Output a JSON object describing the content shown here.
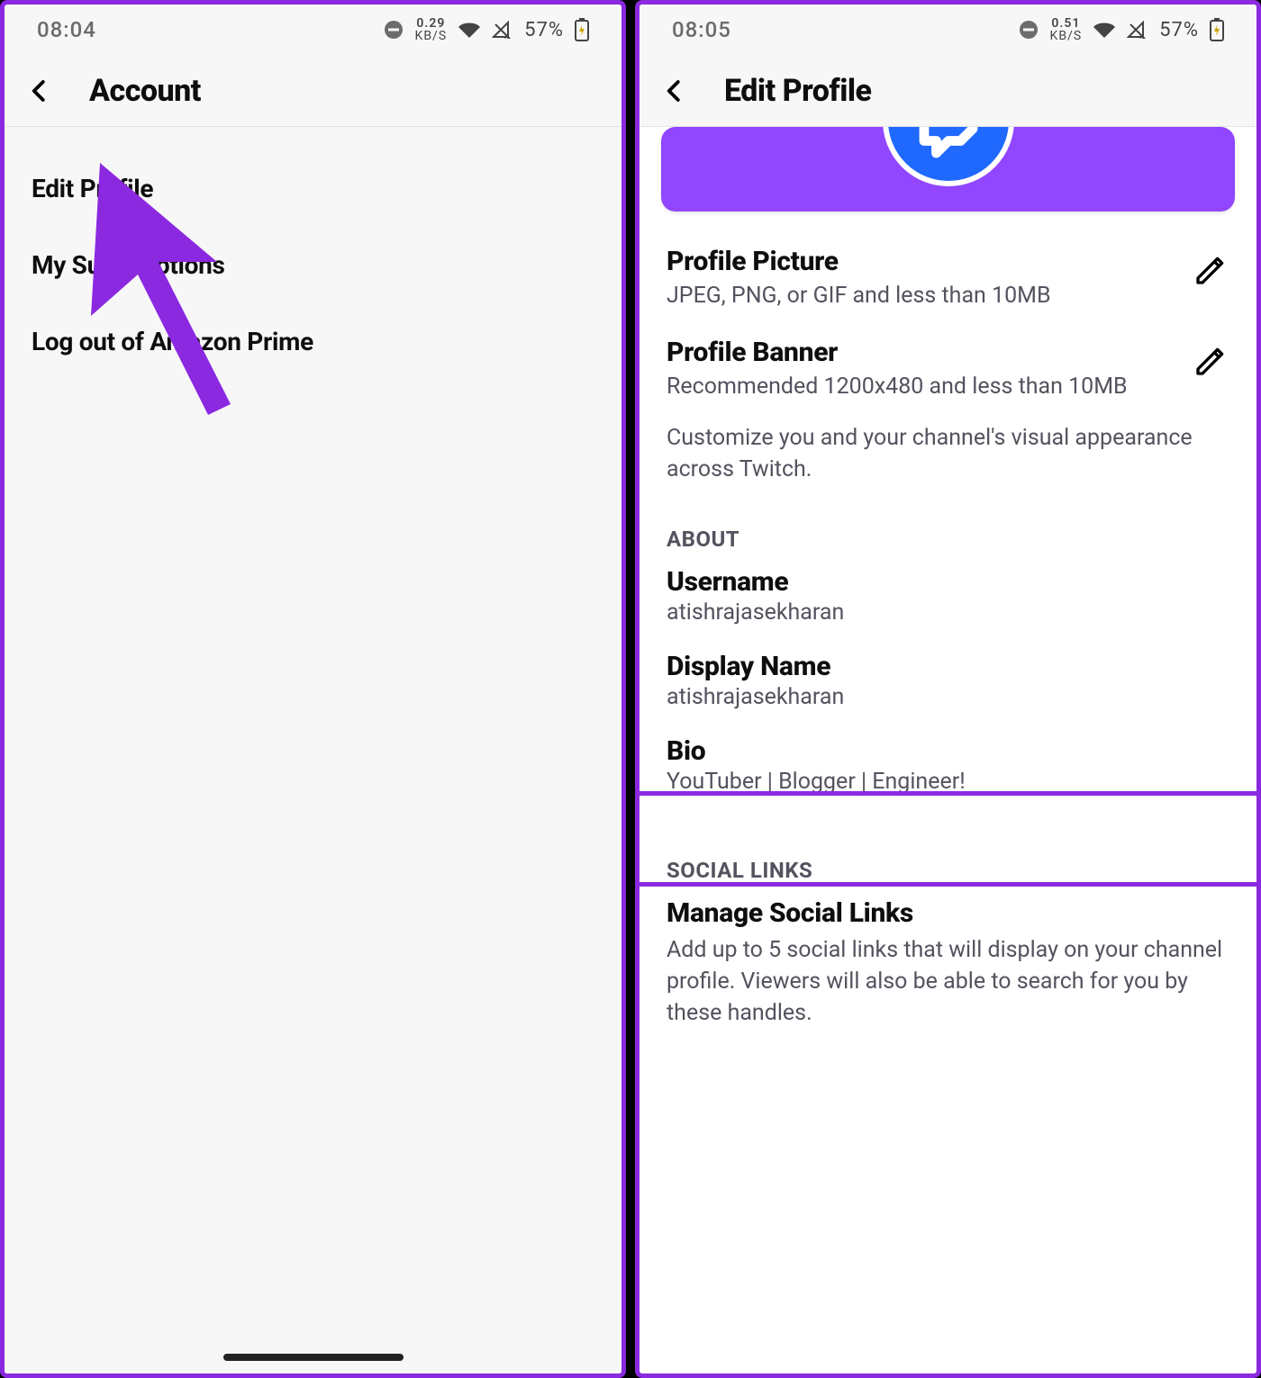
{
  "left": {
    "status": {
      "time": "08:04",
      "speed_num": "0.29",
      "speed_unit": "KB/S",
      "battery": "57%"
    },
    "header": {
      "title": "Account"
    },
    "items": [
      {
        "label": "Edit Profile"
      },
      {
        "label": "My Subscriptions"
      },
      {
        "label": "Log out of Amazon Prime"
      }
    ]
  },
  "right": {
    "status": {
      "time": "08:05",
      "speed_num": "0.51",
      "speed_unit": "KB/S",
      "battery": "57%"
    },
    "header": {
      "title": "Edit Profile"
    },
    "profile_picture": {
      "title": "Profile Picture",
      "sub": "JPEG, PNG, or GIF and less than 10MB"
    },
    "profile_banner": {
      "title": "Profile Banner",
      "sub": "Recommended 1200x480 and less than 10MB"
    },
    "customize_note": "Customize you and your channel's visual appearance across Twitch.",
    "about_header": "ABOUT",
    "username": {
      "label": "Username",
      "value": "atishrajasekharan"
    },
    "display_name": {
      "label": "Display Name",
      "value": "atishrajasekharan"
    },
    "bio": {
      "label": "Bio",
      "value": "YouTuber | Blogger | Engineer!"
    },
    "social_header": "SOCIAL LINKS",
    "manage_social": {
      "title": "Manage Social Links"
    },
    "social_note": "Add up to 5 social links that will display on your channel profile. Viewers will also be able to search for you by these handles."
  }
}
